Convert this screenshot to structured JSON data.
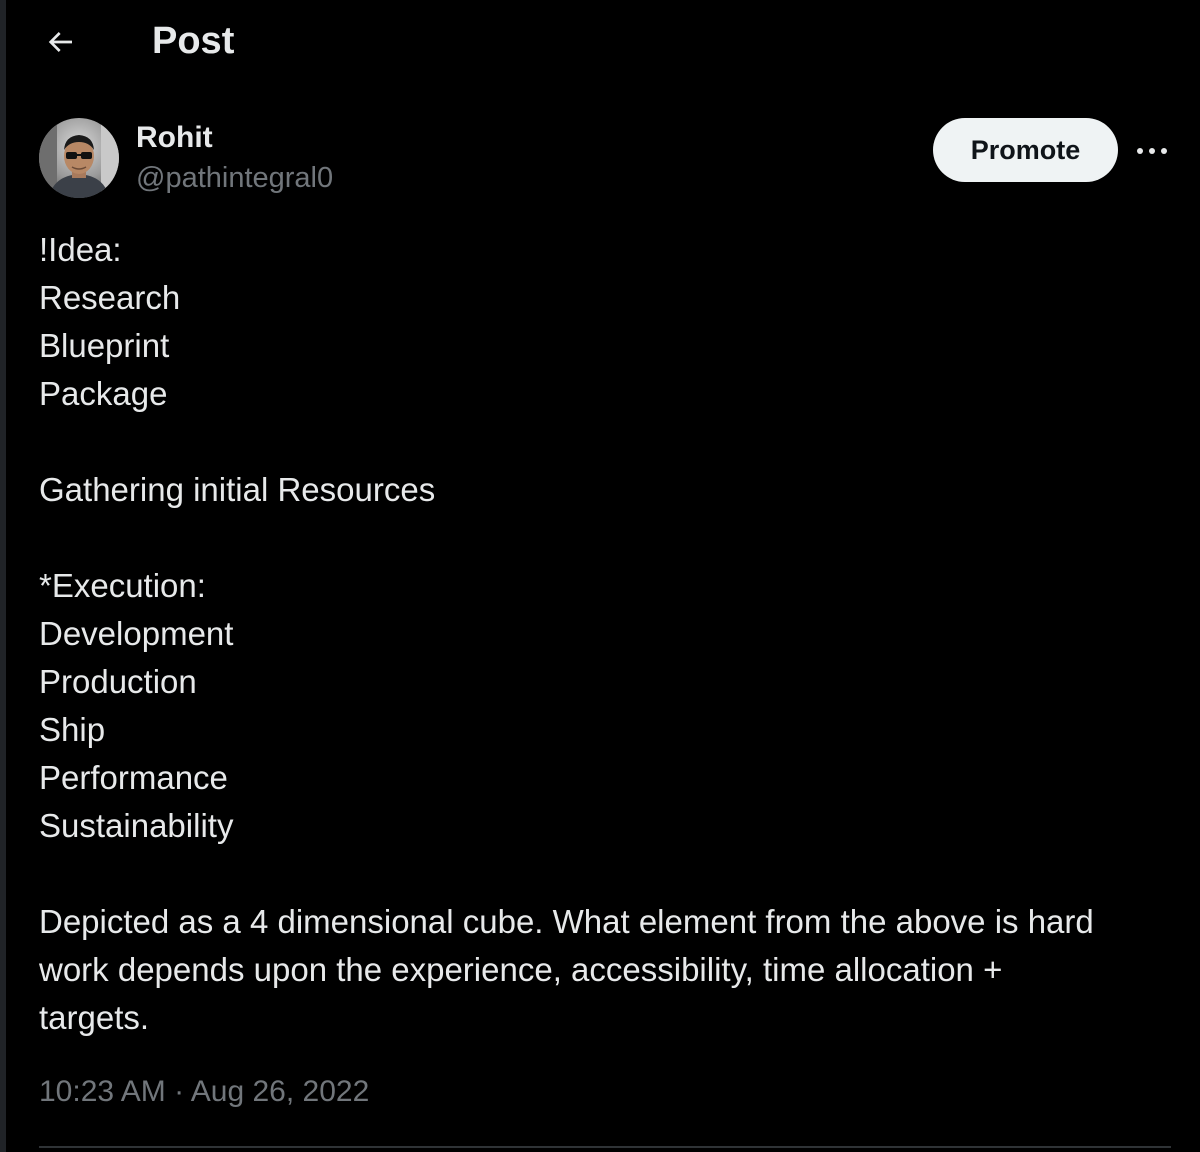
{
  "header": {
    "back_icon": "arrow-left-icon",
    "title": "Post"
  },
  "author": {
    "name": "Rohit",
    "handle": "@pathintegral0",
    "avatar_icon": "user-avatar-photo"
  },
  "actions": {
    "promote_label": "Promote",
    "more_icon": "more-horizontal-icon"
  },
  "post": {
    "lines": [
      "!Idea:",
      "Research",
      "Blueprint",
      "Package",
      "",
      "Gathering initial Resources",
      "",
      "*Execution:",
      "Development",
      "Production",
      "Ship",
      "Performance",
      "Sustainability",
      "",
      "Depicted as a 4 dimensional cube. What element from the above is hard",
      "work depends upon the experience, accessibility, time allocation +",
      "targets."
    ]
  },
  "meta": {
    "time": "10:23 AM",
    "separator": " · ",
    "date": "Aug 26, 2022"
  },
  "colors": {
    "background": "#000000",
    "text_primary": "#e7e9ea",
    "text_secondary": "#71767b",
    "promote_bg": "#eff3f4",
    "divider": "#2f3336"
  }
}
